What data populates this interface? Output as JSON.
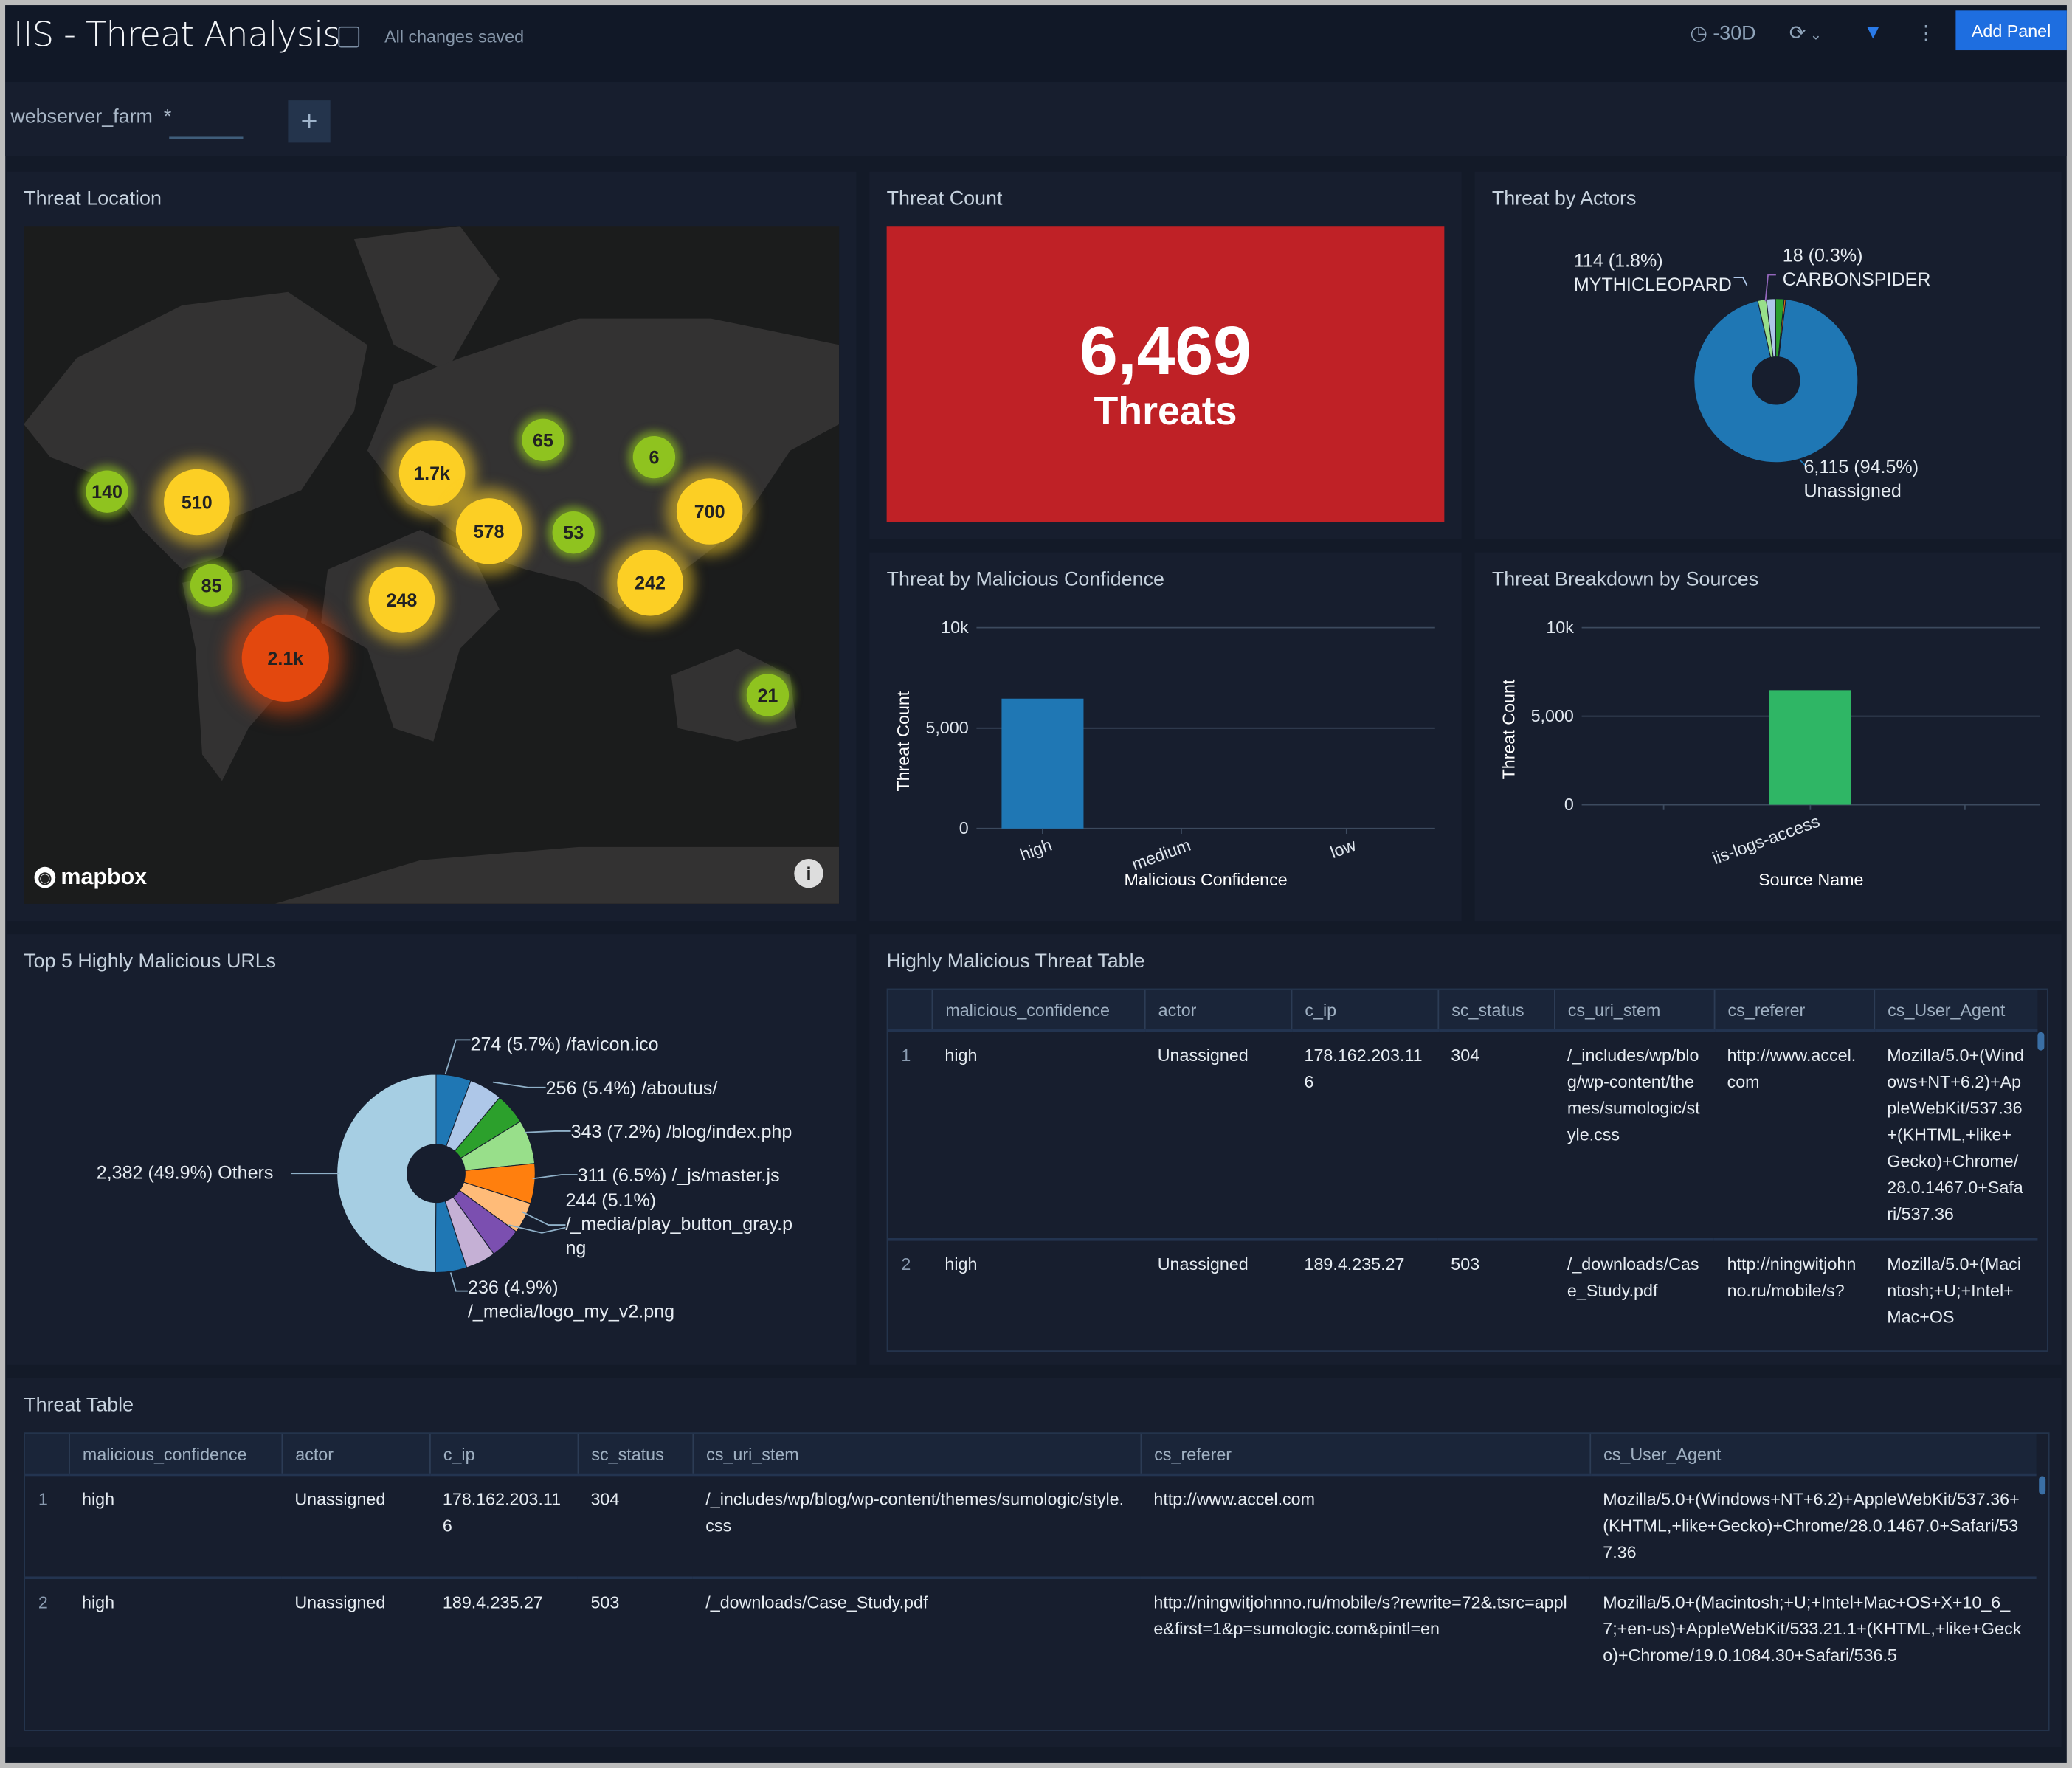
{
  "header": {
    "title": "IIS - Threat Analysis",
    "saved_status": "All changes saved",
    "time_range": "-30D",
    "add_panel": "Add Panel"
  },
  "filters": {
    "name": "webserver_farm",
    "value": "*",
    "add": "+"
  },
  "threat_location": {
    "title": "Threat Location",
    "attribution": "mapbox",
    "info": "i",
    "clusters": [
      {
        "label": "140",
        "level": "low"
      },
      {
        "label": "510",
        "level": "medium"
      },
      {
        "label": "85",
        "level": "low"
      },
      {
        "label": "2.1k",
        "level": "high"
      },
      {
        "label": "1.7k",
        "level": "medium"
      },
      {
        "label": "65",
        "level": "low"
      },
      {
        "label": "6",
        "level": "low"
      },
      {
        "label": "578",
        "level": "medium"
      },
      {
        "label": "53",
        "level": "low"
      },
      {
        "label": "700",
        "level": "medium"
      },
      {
        "label": "242",
        "level": "medium"
      },
      {
        "label": "248",
        "level": "medium"
      },
      {
        "label": "21",
        "level": "low"
      }
    ]
  },
  "threat_count": {
    "title": "Threat Count",
    "value": "6,469",
    "unit": "Threats",
    "color": "#bf2126"
  },
  "chart_data": [
    {
      "type": "pie",
      "title": "Threat by Actors",
      "donut": true,
      "slices": [
        {
          "name": "Unassigned",
          "value": 6115,
          "label": "6,115 (94.5%)",
          "pct": 94.5,
          "color": "#1f77b4"
        },
        {
          "name": "MYTHICLEOPARD",
          "value": 114,
          "label": "114 (1.8%)",
          "pct": 1.8,
          "color": "#aec7e8"
        },
        {
          "name": "CARBONSPIDER",
          "value": 18,
          "label": "18 (0.3%)",
          "pct": 0.3,
          "color": "#ff7f0e"
        }
      ]
    },
    {
      "type": "bar",
      "title": "Threat by Malicious Confidence",
      "xlabel": "Malicious Confidence",
      "ylabel": "Threat Count",
      "ylim": [
        0,
        10000
      ],
      "yticks": [
        "0",
        "5,000",
        "10k"
      ],
      "ytick_values": [
        0,
        5000,
        10000
      ],
      "grid": true,
      "categories": [
        "high",
        "medium",
        "low"
      ],
      "values": [
        6469,
        0,
        0
      ],
      "color": "#1f77b4"
    },
    {
      "type": "bar",
      "title": "Threat Breakdown by Sources",
      "xlabel": "Source Name",
      "ylabel": "Threat Count",
      "ylim": [
        0,
        10000
      ],
      "yticks": [
        "0",
        "5,000",
        "10k"
      ],
      "ytick_values": [
        0,
        5000,
        10000
      ],
      "grid": true,
      "categories": [
        "iis-logs-access"
      ],
      "values": [
        6469
      ],
      "color": "#2fb665"
    },
    {
      "type": "pie",
      "title": "Top 5 Highly Malicious URLs",
      "donut": true,
      "slices": [
        {
          "name": "/favicon.ico",
          "value": 274,
          "pct": 5.7,
          "label": "274 (5.7%) /favicon.ico",
          "color": "#1f77b4"
        },
        {
          "name": "/aboutus/",
          "value": 256,
          "pct": 5.4,
          "label": "256 (5.4%) /aboutus/",
          "color": "#aec7e8"
        },
        {
          "name": "/blog/index.php",
          "value": 343,
          "pct": 7.2,
          "label": "343 (7.2%) /blog/index.php",
          "color": "#98df8a"
        },
        {
          "name": "/_js/master.js",
          "value": 311,
          "pct": 6.5,
          "label": "311 (6.5%) /_js/master.js",
          "color": "#ff7f0e"
        },
        {
          "name": "/_media/play_button_gray.png",
          "value": 244,
          "pct": 5.1,
          "label": "244 (5.1%)",
          "label2": "/_media/play_button_gray.p",
          "label3": "ng",
          "color": "#ffbb78"
        },
        {
          "name": "/_media/logo_my_v2.png",
          "value": 236,
          "pct": 4.9,
          "label": "236 (4.9%)",
          "label2": "/_media/logo_my_v2.png",
          "color": "#c5b0d5"
        },
        {
          "name": "Others",
          "value": 2382,
          "pct": 49.9,
          "label": "2,382 (49.9%) Others",
          "color": "#a6cee3"
        }
      ]
    }
  ],
  "table_columns": [
    "malicious_confidence",
    "actor",
    "c_ip",
    "sc_status",
    "cs_uri_stem",
    "cs_referer",
    "cs_User_Agent"
  ],
  "highly_malicious_table": {
    "title": "Highly Malicious Threat Table",
    "rows": [
      {
        "n": "1",
        "malicious_confidence": "high",
        "actor": "Unassigned",
        "c_ip": "178.162.203.116",
        "sc_status": "304",
        "cs_uri_stem": "/_includes/wp/blog/wp-content/themes/sumologic/style.css",
        "cs_referer": "http://www.accel.com",
        "cs_User_Agent": "Mozilla/5.0+(Windows+NT+6.2)+AppleWebKit/537.36+(KHTML,+like+Gecko)+Chrome/28.0.1467.0+Safari/537.36"
      },
      {
        "n": "2",
        "malicious_confidence": "high",
        "actor": "Unassigned",
        "c_ip": "189.4.235.27",
        "sc_status": "503",
        "cs_uri_stem": "/_downloads/Case_Study.pdf",
        "cs_referer": "http://ningwitjohnno.ru/mobile/s?",
        "cs_User_Agent": "Mozilla/5.0+(Macintosh;+U;+Intel+Mac+OS"
      }
    ]
  },
  "threat_table": {
    "title": "Threat Table",
    "rows": [
      {
        "n": "1",
        "malicious_confidence": "high",
        "actor": "Unassigned",
        "c_ip": "178.162.203.116",
        "sc_status": "304",
        "cs_uri_stem": "/_includes/wp/blog/wp-content/themes/sumologic/style.css",
        "cs_referer": "http://www.accel.com",
        "cs_User_Agent": "Mozilla/5.0+(Windows+NT+6.2)+AppleWebKit/537.36+(KHTML,+like+Gecko)+Chrome/28.0.1467.0+Safari/537.36"
      },
      {
        "n": "2",
        "malicious_confidence": "high",
        "actor": "Unassigned",
        "c_ip": "189.4.235.27",
        "sc_status": "503",
        "cs_uri_stem": "/_downloads/Case_Study.pdf",
        "cs_referer": "http://ningwitjohnno.ru/mobile/s?rewrite=72&.tsrc=apple&first=1&p=sumologic.com&pintl=en",
        "cs_User_Agent": "Mozilla/5.0+(Macintosh;+U;+Intel+Mac+OS+X+10_6_7;+en-us)+AppleWebKit/533.21.1+(KHTML,+like+Gecko)+Chrome/19.0.1084.30+Safari/536.5"
      }
    ]
  }
}
